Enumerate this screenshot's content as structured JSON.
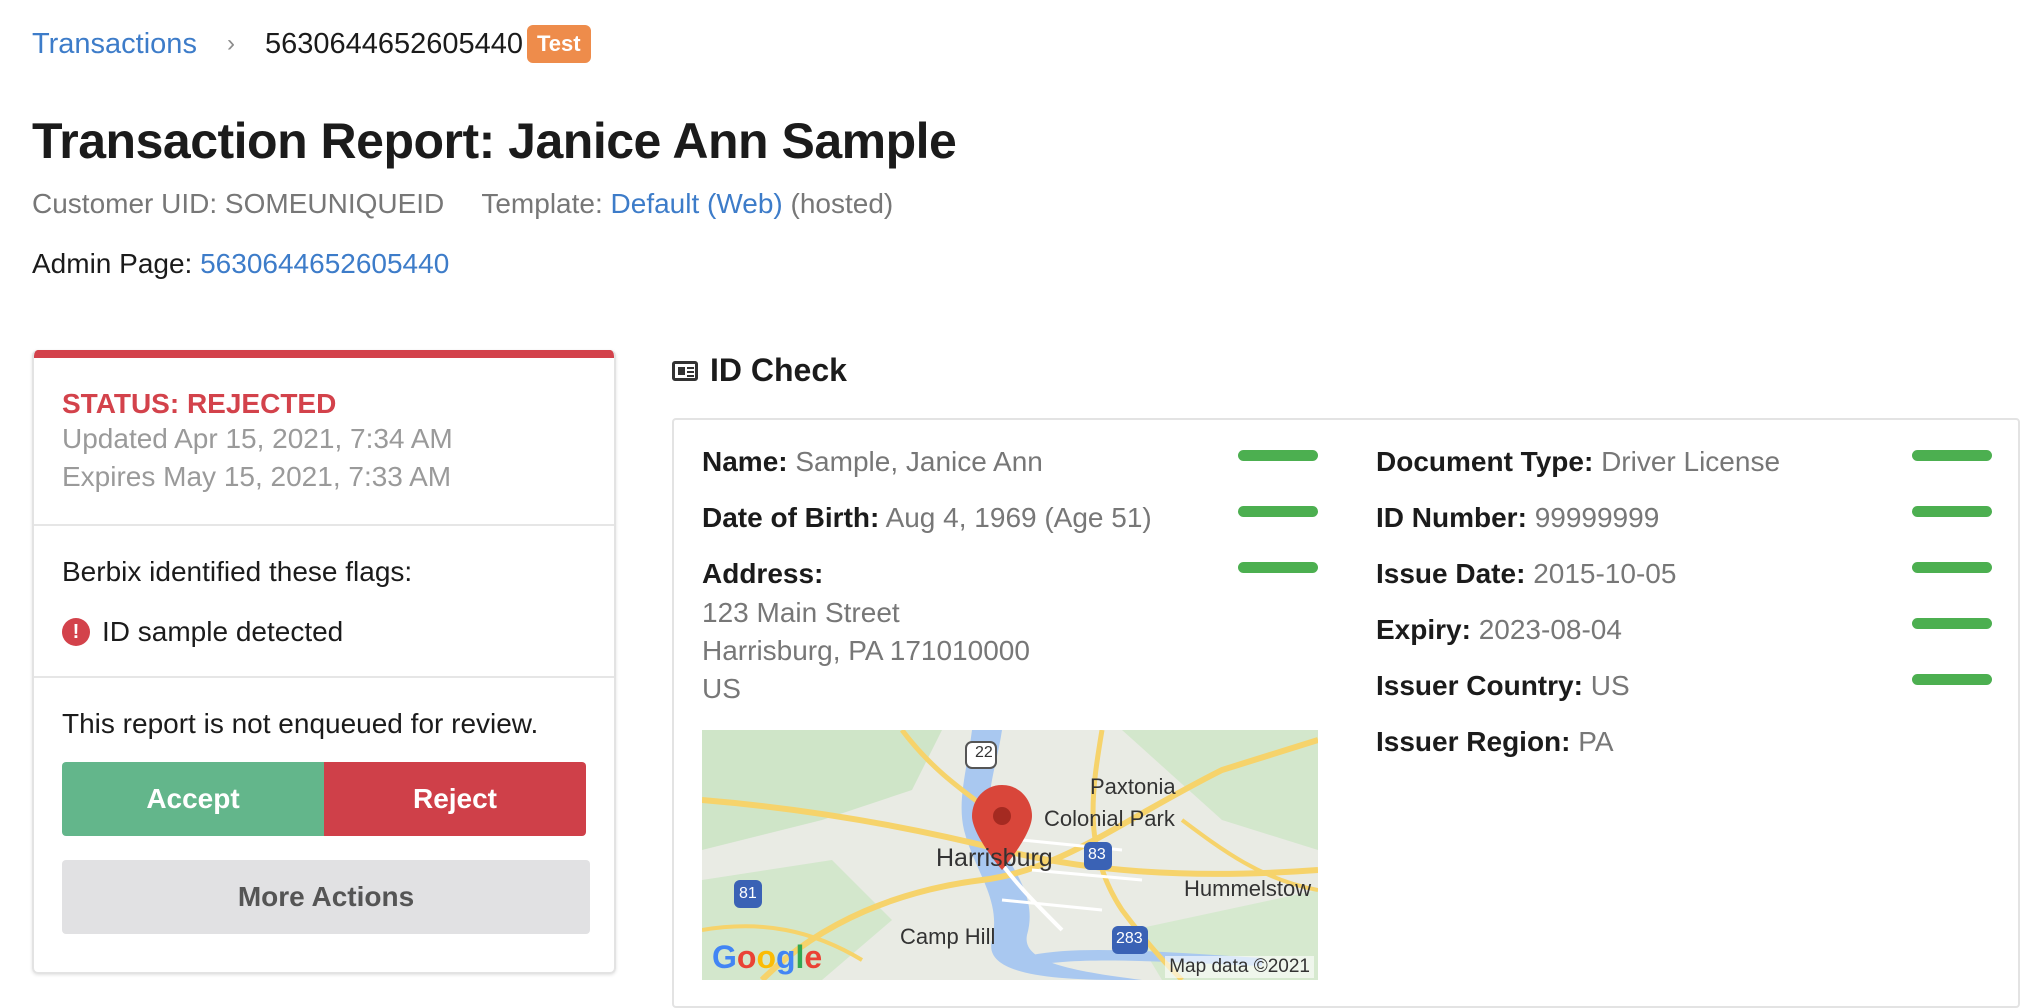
{
  "breadcrumb": {
    "parent": "Transactions",
    "current": "5630644652605440",
    "badge": "Test"
  },
  "page": {
    "title": "Transaction Report: Janice Ann Sample",
    "customer_uid_label": "Customer UID: SOMEUNIQUEID",
    "template_label": "Template:",
    "template_link": "Default (Web)",
    "template_suffix": "(hosted)",
    "admin_label": "Admin Page:",
    "admin_link": "5630644652605440"
  },
  "status_card": {
    "status": "STATUS: REJECTED",
    "updated": "Updated Apr 15, 2021, 7:34 AM",
    "expires": "Expires May 15, 2021, 7:33 AM",
    "flags_title": "Berbix identified these flags:",
    "flags": [
      "ID sample detected"
    ],
    "review_text": "This report is not enqueued for review.",
    "accept_label": "Accept",
    "reject_label": "Reject",
    "more_label": "More Actions",
    "accent_color": "#d3424b"
  },
  "id_check": {
    "heading": "ID Check",
    "left_fields": [
      {
        "label": "Name:",
        "value": "Sample, Janice Ann",
        "ok": true
      },
      {
        "label": "Date of Birth:",
        "value": "Aug 4, 1969 (Age 51)",
        "ok": true
      },
      {
        "label": "Address:",
        "value": "",
        "ok": true
      }
    ],
    "address_lines": [
      "123 Main Street",
      "Harrisburg, PA 171010000",
      "US"
    ],
    "right_fields": [
      {
        "label": "Document Type:",
        "value": "Driver License",
        "ok": true
      },
      {
        "label": "ID Number:",
        "value": "99999999",
        "ok": true
      },
      {
        "label": "Issue Date:",
        "value": "2015-10-05",
        "ok": true
      },
      {
        "label": "Expiry:",
        "value": "2023-08-04",
        "ok": true
      },
      {
        "label": "Issuer Country:",
        "value": "US",
        "ok": true
      },
      {
        "label": "Issuer Region:",
        "value": "PA",
        "ok": false
      }
    ],
    "ok_color": "#4caf50"
  },
  "map": {
    "places": [
      "Paxtonia",
      "Colonial Park",
      "Harrisburg",
      "Hummelstow",
      "Camp Hill"
    ],
    "shields": [
      "22",
      "83",
      "81",
      "283"
    ],
    "logo": "Google",
    "attribution": "Map data ©2021"
  }
}
